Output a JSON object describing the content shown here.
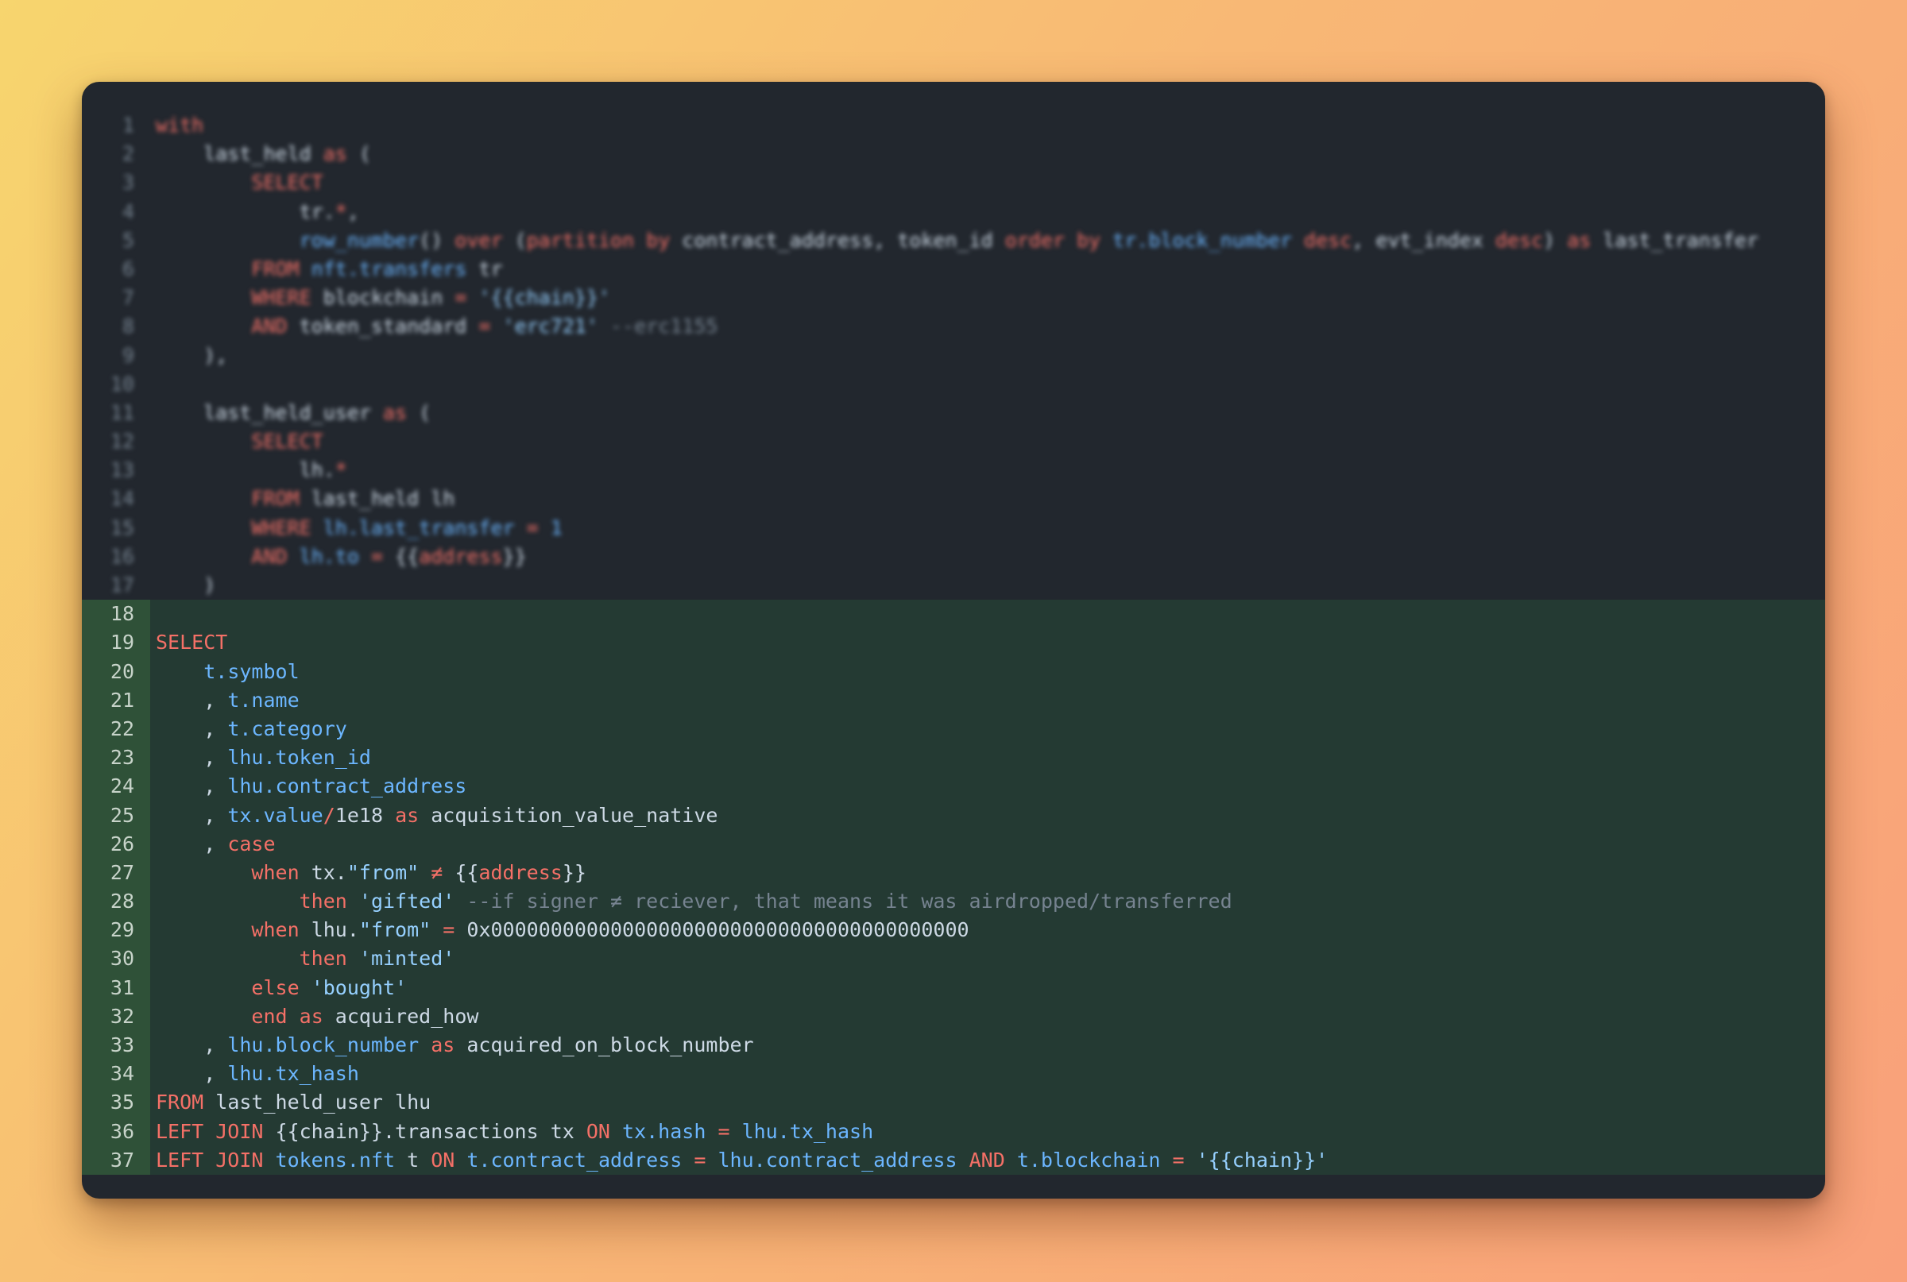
{
  "editor": {
    "language": "sql",
    "highlight_color": "#243a33",
    "gutter_highlight_color": "#2f5138",
    "blurred_lines": "1-17",
    "highlighted_lines": "18-37",
    "lines": [
      {
        "n": "1",
        "seg": [
          {
            "t": "with",
            "c": "kw"
          }
        ]
      },
      {
        "n": "2",
        "seg": [
          {
            "t": "    last_held ",
            "c": "pl"
          },
          {
            "t": "as",
            "c": "kw"
          },
          {
            "t": " (",
            "c": "pl"
          }
        ]
      },
      {
        "n": "3",
        "seg": [
          {
            "t": "        ",
            "c": "pl"
          },
          {
            "t": "SELECT",
            "c": "kw"
          }
        ]
      },
      {
        "n": "4",
        "seg": [
          {
            "t": "            tr.",
            "c": "pl"
          },
          {
            "t": "*",
            "c": "kw"
          },
          {
            "t": ",",
            "c": "pl"
          }
        ]
      },
      {
        "n": "5",
        "seg": [
          {
            "t": "            ",
            "c": "pl"
          },
          {
            "t": "row_number",
            "c": "id"
          },
          {
            "t": "() ",
            "c": "pl"
          },
          {
            "t": "over",
            "c": "kw"
          },
          {
            "t": " (",
            "c": "pl"
          },
          {
            "t": "partition by",
            "c": "kw"
          },
          {
            "t": " contract_address, token_id ",
            "c": "pl"
          },
          {
            "t": "order by",
            "c": "kw"
          },
          {
            "t": " ",
            "c": "pl"
          },
          {
            "t": "tr.block_number",
            "c": "id"
          },
          {
            "t": " ",
            "c": "pl"
          },
          {
            "t": "desc",
            "c": "kw"
          },
          {
            "t": ", evt_index ",
            "c": "pl"
          },
          {
            "t": "desc",
            "c": "kw"
          },
          {
            "t": ") ",
            "c": "pl"
          },
          {
            "t": "as",
            "c": "kw"
          },
          {
            "t": " last_transfer",
            "c": "pl"
          }
        ]
      },
      {
        "n": "6",
        "seg": [
          {
            "t": "        ",
            "c": "pl"
          },
          {
            "t": "FROM",
            "c": "kw"
          },
          {
            "t": " ",
            "c": "pl"
          },
          {
            "t": "nft.transfers",
            "c": "id"
          },
          {
            "t": " tr",
            "c": "pl"
          }
        ]
      },
      {
        "n": "7",
        "seg": [
          {
            "t": "        ",
            "c": "pl"
          },
          {
            "t": "WHERE",
            "c": "kw"
          },
          {
            "t": " blockchain ",
            "c": "pl"
          },
          {
            "t": "=",
            "c": "kw"
          },
          {
            "t": " ",
            "c": "pl"
          },
          {
            "t": "'{{chain}}'",
            "c": "str"
          }
        ]
      },
      {
        "n": "8",
        "seg": [
          {
            "t": "        ",
            "c": "pl"
          },
          {
            "t": "AND",
            "c": "kw"
          },
          {
            "t": " token_standard ",
            "c": "pl"
          },
          {
            "t": "=",
            "c": "kw"
          },
          {
            "t": " ",
            "c": "pl"
          },
          {
            "t": "'erc721'",
            "c": "str"
          },
          {
            "t": " --erc1155",
            "c": "cm"
          }
        ]
      },
      {
        "n": "9",
        "seg": [
          {
            "t": "    ),",
            "c": "pl"
          }
        ]
      },
      {
        "n": "10",
        "seg": [
          {
            "t": "",
            "c": "pl"
          }
        ]
      },
      {
        "n": "11",
        "seg": [
          {
            "t": "    last_held_user ",
            "c": "pl"
          },
          {
            "t": "as",
            "c": "kw"
          },
          {
            "t": " (",
            "c": "pl"
          }
        ]
      },
      {
        "n": "12",
        "seg": [
          {
            "t": "        ",
            "c": "pl"
          },
          {
            "t": "SELECT",
            "c": "kw"
          }
        ]
      },
      {
        "n": "13",
        "seg": [
          {
            "t": "            lh.",
            "c": "pl"
          },
          {
            "t": "*",
            "c": "kw"
          }
        ]
      },
      {
        "n": "14",
        "seg": [
          {
            "t": "        ",
            "c": "pl"
          },
          {
            "t": "FROM",
            "c": "kw"
          },
          {
            "t": " last_held lh",
            "c": "pl"
          }
        ]
      },
      {
        "n": "15",
        "seg": [
          {
            "t": "        ",
            "c": "pl"
          },
          {
            "t": "WHERE",
            "c": "kw"
          },
          {
            "t": " ",
            "c": "pl"
          },
          {
            "t": "lh.last_transfer",
            "c": "id"
          },
          {
            "t": " ",
            "c": "pl"
          },
          {
            "t": "=",
            "c": "kw"
          },
          {
            "t": " ",
            "c": "pl"
          },
          {
            "t": "1",
            "c": "id"
          }
        ]
      },
      {
        "n": "16",
        "seg": [
          {
            "t": "        ",
            "c": "pl"
          },
          {
            "t": "AND",
            "c": "kw"
          },
          {
            "t": " ",
            "c": "pl"
          },
          {
            "t": "lh.to",
            "c": "id"
          },
          {
            "t": " ",
            "c": "pl"
          },
          {
            "t": "=",
            "c": "kw"
          },
          {
            "t": " {{",
            "c": "pl"
          },
          {
            "t": "address",
            "c": "kw"
          },
          {
            "t": "}}",
            "c": "pl"
          }
        ]
      },
      {
        "n": "17",
        "seg": [
          {
            "t": "    )",
            "c": "pl"
          }
        ]
      },
      {
        "n": "18",
        "seg": [
          {
            "t": "",
            "c": "pl"
          }
        ]
      },
      {
        "n": "19",
        "seg": [
          {
            "t": "SELECT",
            "c": "kw"
          }
        ]
      },
      {
        "n": "20",
        "seg": [
          {
            "t": "    ",
            "c": "pl"
          },
          {
            "t": "t.symbol",
            "c": "id"
          }
        ]
      },
      {
        "n": "21",
        "seg": [
          {
            "t": "    , ",
            "c": "pl"
          },
          {
            "t": "t.name",
            "c": "id"
          }
        ]
      },
      {
        "n": "22",
        "seg": [
          {
            "t": "    , ",
            "c": "pl"
          },
          {
            "t": "t.category",
            "c": "id"
          }
        ]
      },
      {
        "n": "23",
        "seg": [
          {
            "t": "    , ",
            "c": "pl"
          },
          {
            "t": "lhu.token_id",
            "c": "id"
          }
        ]
      },
      {
        "n": "24",
        "seg": [
          {
            "t": "    , ",
            "c": "pl"
          },
          {
            "t": "lhu.contract_address",
            "c": "id"
          }
        ]
      },
      {
        "n": "25",
        "seg": [
          {
            "t": "    , ",
            "c": "pl"
          },
          {
            "t": "tx.value",
            "c": "id"
          },
          {
            "t": "/",
            "c": "kw"
          },
          {
            "t": "1e18 ",
            "c": "pl"
          },
          {
            "t": "as",
            "c": "kw"
          },
          {
            "t": " acquisition_value_native",
            "c": "pl"
          }
        ]
      },
      {
        "n": "26",
        "seg": [
          {
            "t": "    , ",
            "c": "pl"
          },
          {
            "t": "case",
            "c": "kw"
          }
        ]
      },
      {
        "n": "27",
        "seg": [
          {
            "t": "        ",
            "c": "pl"
          },
          {
            "t": "when",
            "c": "kw"
          },
          {
            "t": " tx.",
            "c": "pl"
          },
          {
            "t": "\"from\"",
            "c": "str"
          },
          {
            "t": " ",
            "c": "pl"
          },
          {
            "t": "≠",
            "c": "kw"
          },
          {
            "t": " {{",
            "c": "pl"
          },
          {
            "t": "address",
            "c": "kw"
          },
          {
            "t": "}}",
            "c": "pl"
          }
        ]
      },
      {
        "n": "28",
        "seg": [
          {
            "t": "            ",
            "c": "pl"
          },
          {
            "t": "then",
            "c": "kw"
          },
          {
            "t": " ",
            "c": "pl"
          },
          {
            "t": "'gifted'",
            "c": "str"
          },
          {
            "t": " --if signer ≠ reciever, that means it was airdropped/transferred",
            "c": "cm"
          }
        ]
      },
      {
        "n": "29",
        "seg": [
          {
            "t": "        ",
            "c": "pl"
          },
          {
            "t": "when",
            "c": "kw"
          },
          {
            "t": " lhu.",
            "c": "pl"
          },
          {
            "t": "\"from\"",
            "c": "str"
          },
          {
            "t": " ",
            "c": "pl"
          },
          {
            "t": "=",
            "c": "kw"
          },
          {
            "t": " 0x0000000000000000000000000000000000000000",
            "c": "pl"
          }
        ]
      },
      {
        "n": "30",
        "seg": [
          {
            "t": "            ",
            "c": "pl"
          },
          {
            "t": "then",
            "c": "kw"
          },
          {
            "t": " ",
            "c": "pl"
          },
          {
            "t": "'minted'",
            "c": "str"
          }
        ]
      },
      {
        "n": "31",
        "seg": [
          {
            "t": "        ",
            "c": "pl"
          },
          {
            "t": "else",
            "c": "kw"
          },
          {
            "t": " ",
            "c": "pl"
          },
          {
            "t": "'bought'",
            "c": "str"
          }
        ]
      },
      {
        "n": "32",
        "seg": [
          {
            "t": "        ",
            "c": "pl"
          },
          {
            "t": "end",
            "c": "kw"
          },
          {
            "t": " ",
            "c": "pl"
          },
          {
            "t": "as",
            "c": "kw"
          },
          {
            "t": " acquired_how",
            "c": "pl"
          }
        ]
      },
      {
        "n": "33",
        "seg": [
          {
            "t": "    , ",
            "c": "pl"
          },
          {
            "t": "lhu.block_number",
            "c": "id"
          },
          {
            "t": " ",
            "c": "pl"
          },
          {
            "t": "as",
            "c": "kw"
          },
          {
            "t": " acquired_on_block_number",
            "c": "pl"
          }
        ]
      },
      {
        "n": "34",
        "seg": [
          {
            "t": "    , ",
            "c": "pl"
          },
          {
            "t": "lhu.tx_hash",
            "c": "id"
          }
        ]
      },
      {
        "n": "35",
        "seg": [
          {
            "t": "FROM",
            "c": "kw"
          },
          {
            "t": " last_held_user lhu",
            "c": "pl"
          }
        ]
      },
      {
        "n": "36",
        "seg": [
          {
            "t": "LEFT JOIN",
            "c": "kw"
          },
          {
            "t": " {{chain}}.transactions tx ",
            "c": "pl"
          },
          {
            "t": "ON",
            "c": "kw"
          },
          {
            "t": " ",
            "c": "pl"
          },
          {
            "t": "tx.hash",
            "c": "id"
          },
          {
            "t": " ",
            "c": "pl"
          },
          {
            "t": "=",
            "c": "kw"
          },
          {
            "t": " ",
            "c": "pl"
          },
          {
            "t": "lhu.tx_hash",
            "c": "id"
          }
        ]
      },
      {
        "n": "37",
        "seg": [
          {
            "t": "LEFT JOIN",
            "c": "kw"
          },
          {
            "t": " ",
            "c": "pl"
          },
          {
            "t": "tokens.nft",
            "c": "id"
          },
          {
            "t": " t ",
            "c": "pl"
          },
          {
            "t": "ON",
            "c": "kw"
          },
          {
            "t": " ",
            "c": "pl"
          },
          {
            "t": "t.contract_address",
            "c": "id"
          },
          {
            "t": " ",
            "c": "pl"
          },
          {
            "t": "=",
            "c": "kw"
          },
          {
            "t": " ",
            "c": "pl"
          },
          {
            "t": "lhu.contract_address",
            "c": "id"
          },
          {
            "t": " ",
            "c": "pl"
          },
          {
            "t": "AND",
            "c": "kw"
          },
          {
            "t": " ",
            "c": "pl"
          },
          {
            "t": "t.blockchain",
            "c": "id"
          },
          {
            "t": " ",
            "c": "pl"
          },
          {
            "t": "=",
            "c": "kw"
          },
          {
            "t": " ",
            "c": "pl"
          },
          {
            "t": "'{{chain}}'",
            "c": "str"
          }
        ]
      }
    ]
  }
}
